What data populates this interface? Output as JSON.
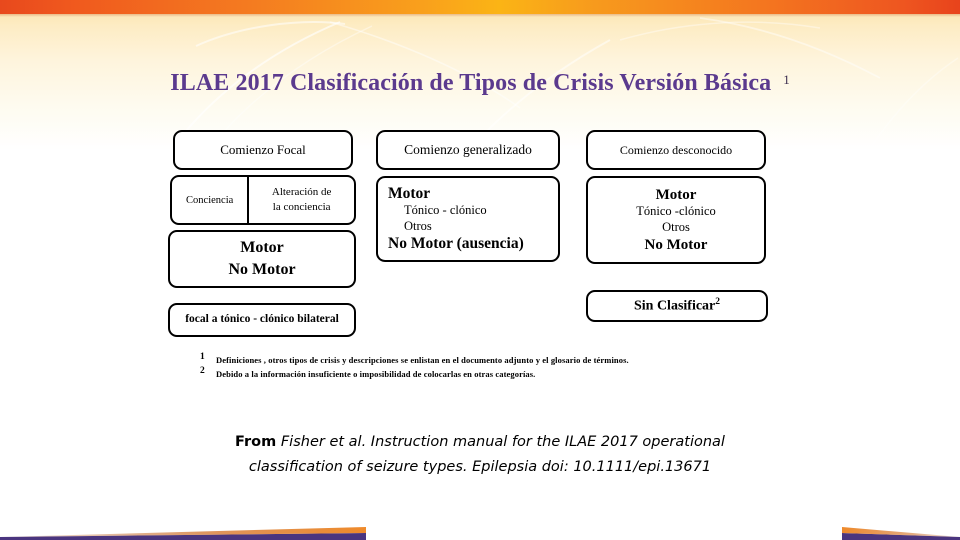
{
  "slide": {
    "title": "ILAE 2017 Clasificación de Tipos de Crisis Versión Básica",
    "title_superscript": "1",
    "colors": {
      "title": "#5b3a8e",
      "top_bar_orange": "#f4751f",
      "bottom_wedge_purple": "#4a357f",
      "background_top": "#fbe2a8",
      "background_bottom": "#ffffff",
      "box_border": "#000000"
    }
  },
  "columns": {
    "focal": {
      "header": "Comienzo Focal",
      "awareness": {
        "left": "Conciencia",
        "right_line1": "Alteración de",
        "right_line2": "la conciencia"
      },
      "motor_box": {
        "line1": "Motor",
        "line2": "No Motor"
      },
      "bilateral": "focal a tónico - clónico bilateral"
    },
    "generalized": {
      "header": "Comienzo generalizado",
      "detail": {
        "motor_header": "Motor",
        "motor_items": [
          "Tónico - clónico",
          "Otros"
        ],
        "no_motor": "No Motor (ausencia)"
      }
    },
    "unknown": {
      "header": "Comienzo desconocido",
      "detail": {
        "motor_header": "Motor",
        "motor_items": [
          "Tónico -clónico",
          "Otros"
        ],
        "no_motor": "No Motor"
      },
      "unclassified": {
        "label": "Sin Clasificar",
        "superscript": "2"
      }
    }
  },
  "footnotes": [
    {
      "marker": "1",
      "text": "Definiciones , otros tipos de crisis y descripciones se enlistan en el documento adjunto y el glosario de términos."
    },
    {
      "marker": "2",
      "text": "Debido a la información insuficiente o imposibilidad de colocarlas en otras categorías."
    }
  ],
  "citation": {
    "prefix": "From",
    "line1": "Fisher et al. Instruction manual for the ILAE 2017 operational",
    "line2": "classification of seizure types. Epilepsia doi: 10.1111/epi.13671"
  }
}
